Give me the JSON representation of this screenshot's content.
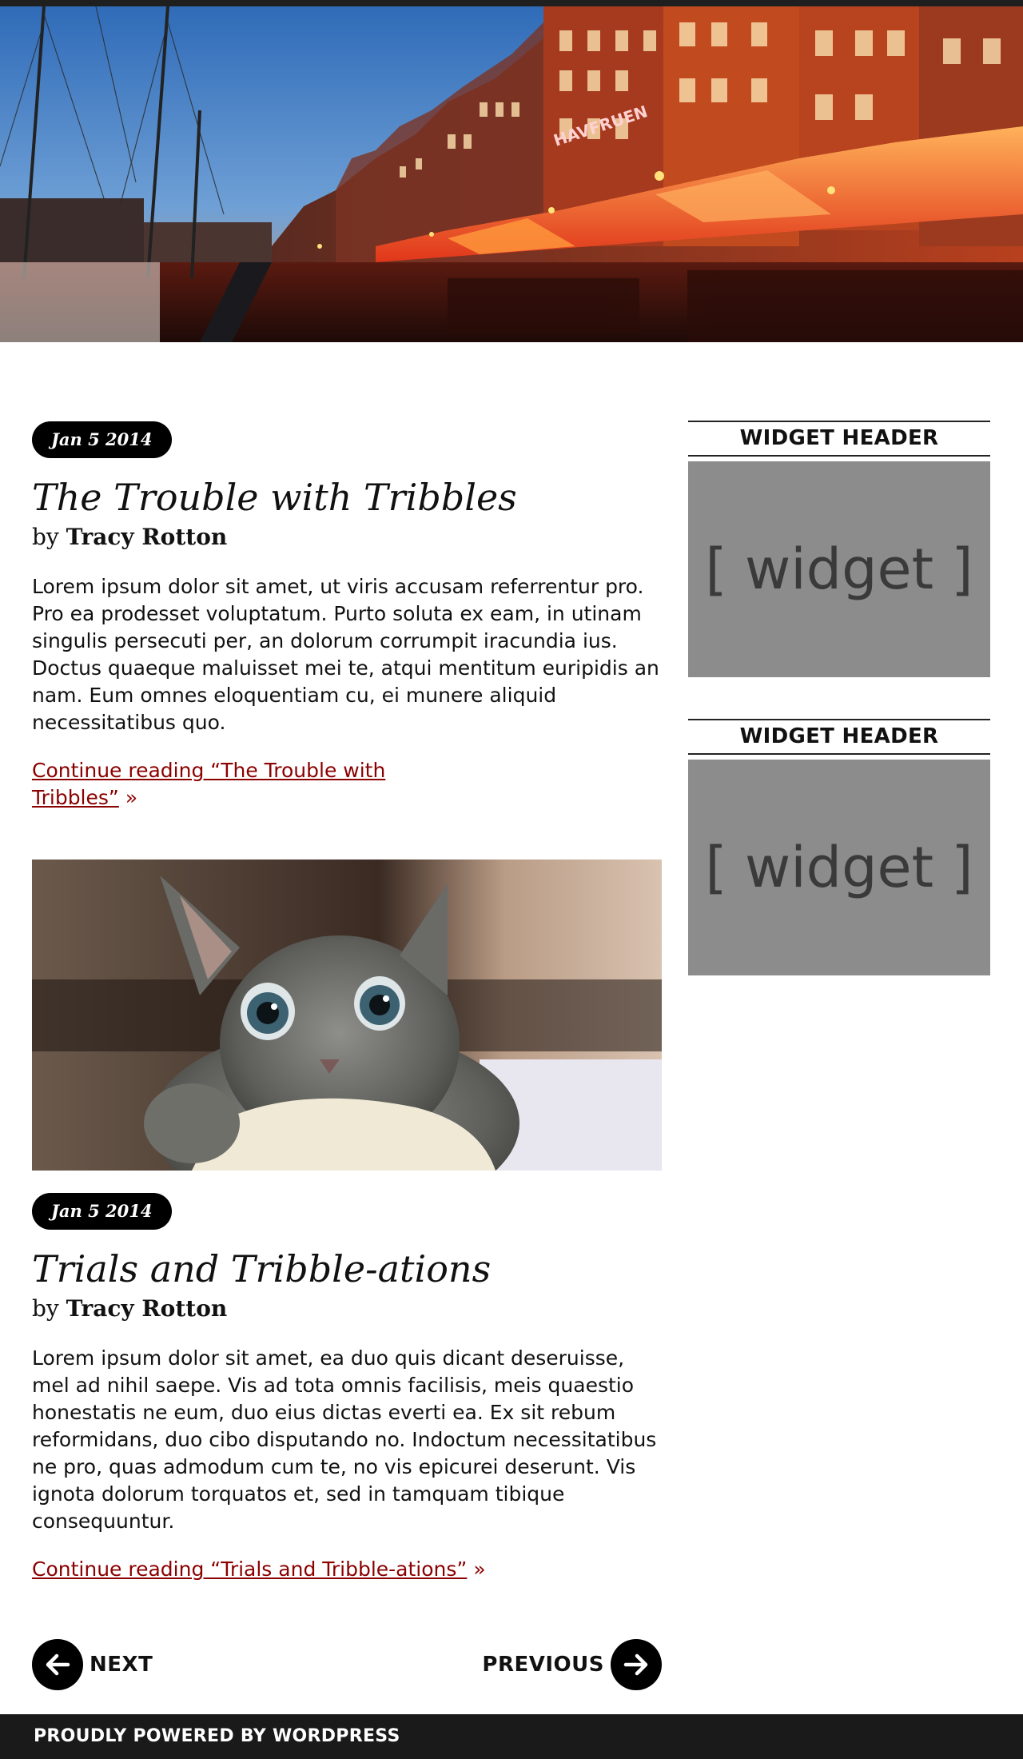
{
  "posts": [
    {
      "date": "Jan 5 2014",
      "title": "The Trouble with Tribbles",
      "by": "by",
      "author": "Tracy Rotton",
      "excerpt": "Lorem ipsum dolor sit amet, ut viris accusam referrentur pro. Pro ea prodesset voluptatum. Purto soluta ex eam, in utinam singulis persecuti per, an dolorum corrumpit iracundia ius. Doctus quaeque maluisset mei te, atqui mentitum euripidis an nam. Eum omnes eloquentiam cu, ei munere aliquid necessitatibus quo.",
      "more_link": "Continue reading “The Trouble with Tribbles”",
      "more_suffix": "»"
    },
    {
      "date": "Jan 5 2014",
      "title": "Trials and Tribble-ations",
      "by": "by",
      "author": "Tracy Rotton",
      "excerpt": "Lorem ipsum dolor sit amet, ea duo quis dicant deseruisse, mel ad nihil saepe. Vis ad tota omnis facilisis, meis quaestio honestatis ne eum, duo eius dictas everti ea. Ex sit rebum reformidans, duo cibo disputando no. Indoctum necessitatibus ne pro, quas admodum cum te, no vis epicurei deserunt. Vis ignota dolorum torquatos et, sed in tamquam tibique consequuntur.",
      "more_link": "Continue reading “Trials and Tribble-ations”",
      "more_suffix": "»"
    }
  ],
  "hero": {
    "sign_text": "HAVFRUEN"
  },
  "pagination": {
    "next_label": "NEXT",
    "previous_label": "PREVIOUS"
  },
  "sidebar": {
    "widgets": [
      {
        "header": "WIDGET HEADER",
        "body": "[ widget ]"
      },
      {
        "header": "WIDGET HEADER",
        "body": "[ widget ]"
      }
    ]
  },
  "footer": {
    "credit": "PROUDLY POWERED BY WORDPRESS"
  },
  "colors": {
    "link": "#8b0000",
    "badge": "#000000",
    "footer_bg": "#1a1a1a",
    "widget_bg": "#8c8c8c"
  },
  "icons": {
    "next": "arrow-left-icon",
    "previous": "arrow-right-icon"
  }
}
